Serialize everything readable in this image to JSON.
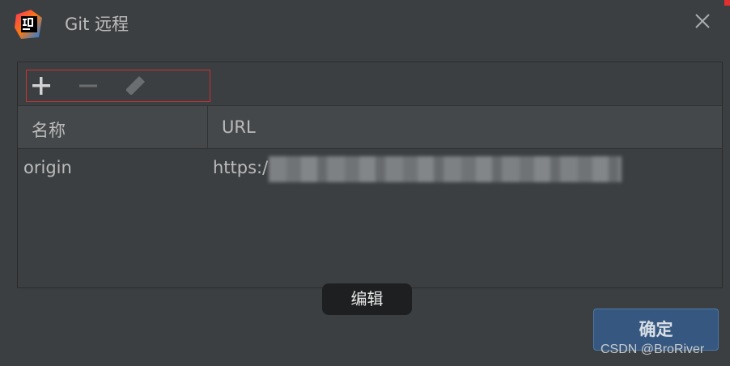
{
  "window": {
    "title": "Git 远程",
    "logo_icon": "intellij-app-icon",
    "close_icon": "close-icon"
  },
  "toolbar": {
    "add_icon": "plus-icon",
    "remove_icon": "minus-icon",
    "edit_icon": "pencil-icon",
    "highlight_color": "#c83232"
  },
  "table": {
    "columns": [
      "名称",
      "URL"
    ],
    "rows": [
      {
        "name": "origin",
        "url": "https:/"
      }
    ]
  },
  "tooltip": {
    "text": "编辑"
  },
  "footer": {
    "ok_label": "确定"
  },
  "watermark": {
    "text": "CSDN @BroRiver"
  },
  "colors": {
    "background": "#3c3f41",
    "header": "#45484a",
    "primary_button": "#365880",
    "text": "#bbbbbb"
  }
}
